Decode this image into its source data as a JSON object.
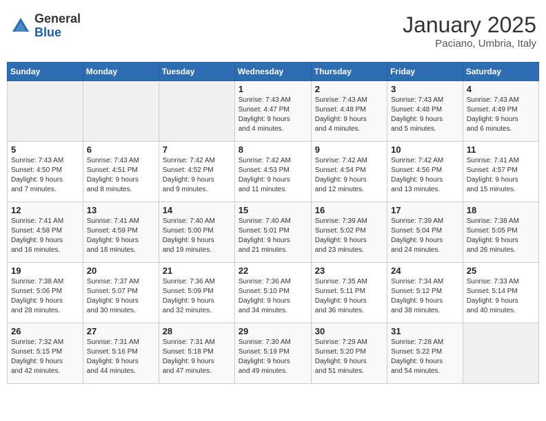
{
  "header": {
    "logo_general": "General",
    "logo_blue": "Blue",
    "month_title": "January 2025",
    "location": "Paciano, Umbria, Italy"
  },
  "weekdays": [
    "Sunday",
    "Monday",
    "Tuesday",
    "Wednesday",
    "Thursday",
    "Friday",
    "Saturday"
  ],
  "weeks": [
    [
      {
        "day": "",
        "info": ""
      },
      {
        "day": "",
        "info": ""
      },
      {
        "day": "",
        "info": ""
      },
      {
        "day": "1",
        "info": "Sunrise: 7:43 AM\nSunset: 4:47 PM\nDaylight: 9 hours\nand 4 minutes."
      },
      {
        "day": "2",
        "info": "Sunrise: 7:43 AM\nSunset: 4:48 PM\nDaylight: 9 hours\nand 4 minutes."
      },
      {
        "day": "3",
        "info": "Sunrise: 7:43 AM\nSunset: 4:48 PM\nDaylight: 9 hours\nand 5 minutes."
      },
      {
        "day": "4",
        "info": "Sunrise: 7:43 AM\nSunset: 4:49 PM\nDaylight: 9 hours\nand 6 minutes."
      }
    ],
    [
      {
        "day": "5",
        "info": "Sunrise: 7:43 AM\nSunset: 4:50 PM\nDaylight: 9 hours\nand 7 minutes."
      },
      {
        "day": "6",
        "info": "Sunrise: 7:43 AM\nSunset: 4:51 PM\nDaylight: 9 hours\nand 8 minutes."
      },
      {
        "day": "7",
        "info": "Sunrise: 7:42 AM\nSunset: 4:52 PM\nDaylight: 9 hours\nand 9 minutes."
      },
      {
        "day": "8",
        "info": "Sunrise: 7:42 AM\nSunset: 4:53 PM\nDaylight: 9 hours\nand 11 minutes."
      },
      {
        "day": "9",
        "info": "Sunrise: 7:42 AM\nSunset: 4:54 PM\nDaylight: 9 hours\nand 12 minutes."
      },
      {
        "day": "10",
        "info": "Sunrise: 7:42 AM\nSunset: 4:56 PM\nDaylight: 9 hours\nand 13 minutes."
      },
      {
        "day": "11",
        "info": "Sunrise: 7:41 AM\nSunset: 4:57 PM\nDaylight: 9 hours\nand 15 minutes."
      }
    ],
    [
      {
        "day": "12",
        "info": "Sunrise: 7:41 AM\nSunset: 4:58 PM\nDaylight: 9 hours\nand 16 minutes."
      },
      {
        "day": "13",
        "info": "Sunrise: 7:41 AM\nSunset: 4:59 PM\nDaylight: 9 hours\nand 18 minutes."
      },
      {
        "day": "14",
        "info": "Sunrise: 7:40 AM\nSunset: 5:00 PM\nDaylight: 9 hours\nand 19 minutes."
      },
      {
        "day": "15",
        "info": "Sunrise: 7:40 AM\nSunset: 5:01 PM\nDaylight: 9 hours\nand 21 minutes."
      },
      {
        "day": "16",
        "info": "Sunrise: 7:39 AM\nSunset: 5:02 PM\nDaylight: 9 hours\nand 23 minutes."
      },
      {
        "day": "17",
        "info": "Sunrise: 7:39 AM\nSunset: 5:04 PM\nDaylight: 9 hours\nand 24 minutes."
      },
      {
        "day": "18",
        "info": "Sunrise: 7:38 AM\nSunset: 5:05 PM\nDaylight: 9 hours\nand 26 minutes."
      }
    ],
    [
      {
        "day": "19",
        "info": "Sunrise: 7:38 AM\nSunset: 5:06 PM\nDaylight: 9 hours\nand 28 minutes."
      },
      {
        "day": "20",
        "info": "Sunrise: 7:37 AM\nSunset: 5:07 PM\nDaylight: 9 hours\nand 30 minutes."
      },
      {
        "day": "21",
        "info": "Sunrise: 7:36 AM\nSunset: 5:09 PM\nDaylight: 9 hours\nand 32 minutes."
      },
      {
        "day": "22",
        "info": "Sunrise: 7:36 AM\nSunset: 5:10 PM\nDaylight: 9 hours\nand 34 minutes."
      },
      {
        "day": "23",
        "info": "Sunrise: 7:35 AM\nSunset: 5:11 PM\nDaylight: 9 hours\nand 36 minutes."
      },
      {
        "day": "24",
        "info": "Sunrise: 7:34 AM\nSunset: 5:12 PM\nDaylight: 9 hours\nand 38 minutes."
      },
      {
        "day": "25",
        "info": "Sunrise: 7:33 AM\nSunset: 5:14 PM\nDaylight: 9 hours\nand 40 minutes."
      }
    ],
    [
      {
        "day": "26",
        "info": "Sunrise: 7:32 AM\nSunset: 5:15 PM\nDaylight: 9 hours\nand 42 minutes."
      },
      {
        "day": "27",
        "info": "Sunrise: 7:31 AM\nSunset: 5:16 PM\nDaylight: 9 hours\nand 44 minutes."
      },
      {
        "day": "28",
        "info": "Sunrise: 7:31 AM\nSunset: 5:18 PM\nDaylight: 9 hours\nand 47 minutes."
      },
      {
        "day": "29",
        "info": "Sunrise: 7:30 AM\nSunset: 5:19 PM\nDaylight: 9 hours\nand 49 minutes."
      },
      {
        "day": "30",
        "info": "Sunrise: 7:29 AM\nSunset: 5:20 PM\nDaylight: 9 hours\nand 51 minutes."
      },
      {
        "day": "31",
        "info": "Sunrise: 7:28 AM\nSunset: 5:22 PM\nDaylight: 9 hours\nand 54 minutes."
      },
      {
        "day": "",
        "info": ""
      }
    ]
  ]
}
